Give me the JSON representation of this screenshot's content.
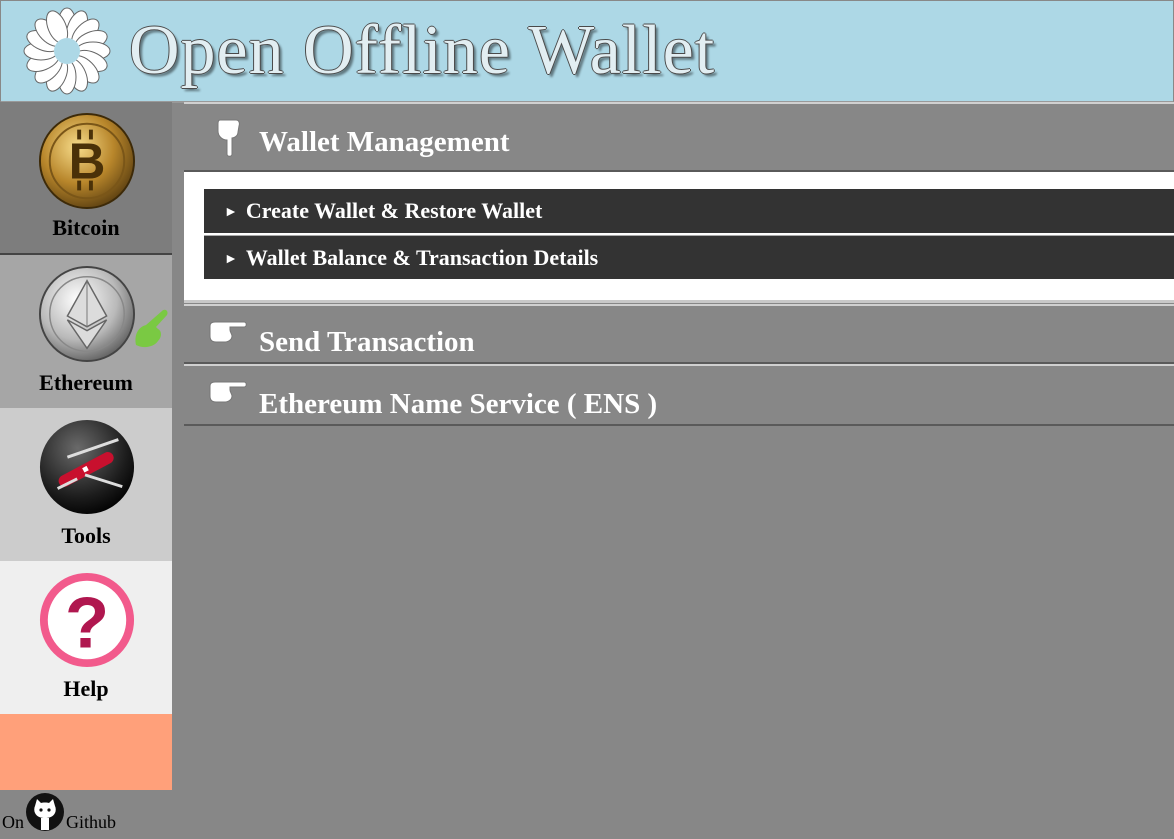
{
  "header": {
    "title": "Open Offline Wallet",
    "logo_icon": "flower-logo-icon"
  },
  "sidebar": {
    "items": [
      {
        "label": "Bitcoin",
        "icon": "bitcoin-coin-icon"
      },
      {
        "label": "Ethereum",
        "icon": "ethereum-coin-icon"
      },
      {
        "label": "Tools",
        "icon": "swiss-army-knife-icon"
      },
      {
        "label": "Help",
        "icon": "question-mark-icon"
      }
    ],
    "github": {
      "prefix": "On",
      "label": "Github",
      "icon": "github-octocat-icon"
    }
  },
  "main": {
    "sections": [
      {
        "title": "Wallet Management",
        "expanded": true,
        "items": [
          {
            "label": "Create Wallet & Restore Wallet"
          },
          {
            "label": "Wallet Balance & Transaction Details"
          }
        ]
      },
      {
        "title": "Send Transaction",
        "expanded": false
      },
      {
        "title": "Ethereum Name Service ( ENS )",
        "expanded": false
      }
    ]
  },
  "colors": {
    "header_bg": "#add8e6",
    "sidebar_bitcoin": "#7d7d7d",
    "sidebar_ethereum": "#a6a6a6",
    "sidebar_tools": "#cccccc",
    "sidebar_help": "#efefef",
    "sidebar_empty": "#ffa07a",
    "main_bg": "#878787",
    "submenu_bg": "#333333",
    "active_hand": "#7ac943"
  }
}
